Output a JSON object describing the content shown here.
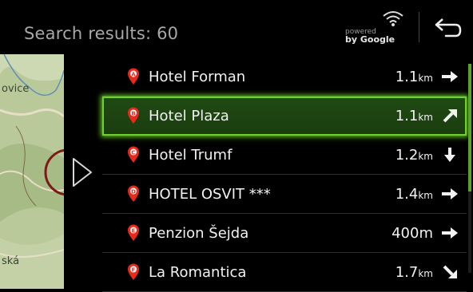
{
  "header": {
    "title": "Search results: 60",
    "powered_line1": "powered",
    "powered_line2": "by Google",
    "wifi_icon": "wifi-icon",
    "back_icon": "back-arrow-icon"
  },
  "map": {
    "label_top": "ovice",
    "label_bottom": "ská"
  },
  "results": [
    {
      "badge": "A",
      "name": "Hotel Forman",
      "distance": "1.1",
      "unit": "km",
      "direction": "right",
      "selected": false
    },
    {
      "badge": "B",
      "name": "Hotel Plaza",
      "distance": "1.1",
      "unit": "km",
      "direction": "up-right",
      "selected": true
    },
    {
      "badge": "C",
      "name": "Hotel Trumf",
      "distance": "1.2",
      "unit": "km",
      "direction": "down",
      "selected": false
    },
    {
      "badge": "D",
      "name": "HOTEL OSVIT ***",
      "distance": "1.4",
      "unit": "km",
      "direction": "right",
      "selected": false
    },
    {
      "badge": "E",
      "name": "Penzion Šejda",
      "distance": "400m",
      "unit": "",
      "direction": "right",
      "selected": false
    },
    {
      "badge": "F",
      "name": "La Romantica",
      "distance": "1.7",
      "unit": "km",
      "direction": "down-right",
      "selected": false
    }
  ],
  "colors": {
    "accent": "#6fd12b",
    "pin": "#e8291c",
    "text": "#f2f2f2",
    "title": "#a7a7a7"
  }
}
